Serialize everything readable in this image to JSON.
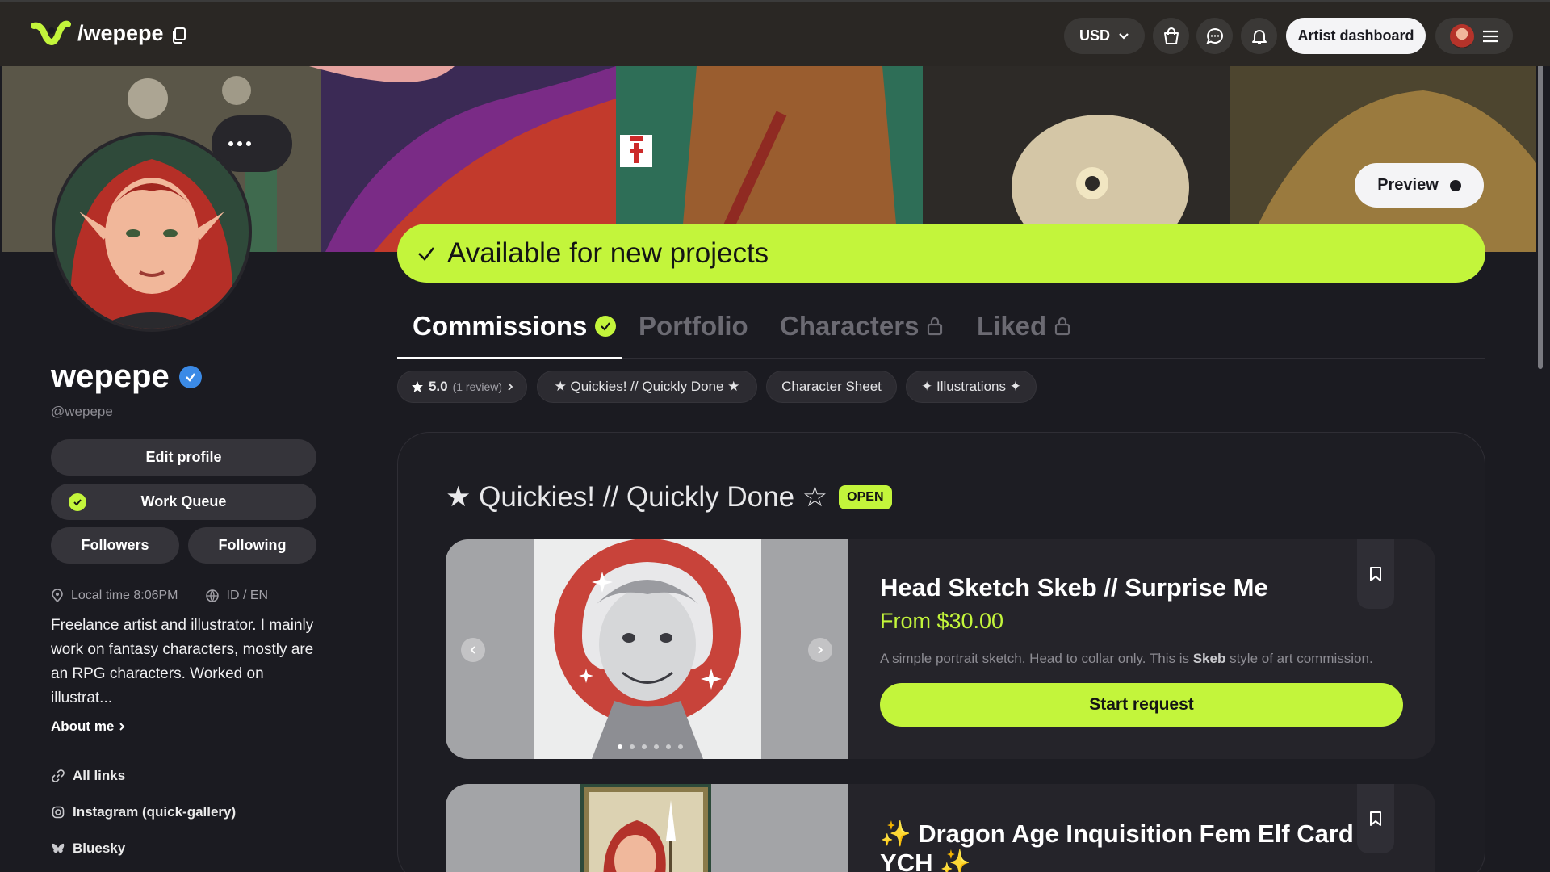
{
  "header": {
    "handle": "/wepepe",
    "currency": "USD",
    "artist_dashboard": "Artist dashboard",
    "icons": [
      "logo-icon",
      "copy-icon",
      "cart-icon",
      "chat-icon",
      "bell-icon",
      "menu-icon"
    ]
  },
  "banner": {
    "preview_label": "Preview",
    "availability": "Available for new projects"
  },
  "profile": {
    "username": "wepepe",
    "at_handle": "@wepepe",
    "edit_profile": "Edit profile",
    "work_queue": "Work Queue",
    "followers": "Followers",
    "following": "Following",
    "local_time": "Local time 8:06PM",
    "languages": "ID / EN",
    "bio": "Freelance artist and illustrator. I mainly work on fantasy characters, mostly are an RPG characters. Worked on illustrat...",
    "about_me": "About me",
    "links": [
      {
        "label": "All links",
        "icon": "link-icon"
      },
      {
        "label": "Instagram (quick-gallery)",
        "icon": "instagram-icon"
      },
      {
        "label": "Bluesky",
        "icon": "bluesky-icon"
      }
    ]
  },
  "tabs": [
    {
      "label": "Commissions",
      "active": true,
      "badge": "check"
    },
    {
      "label": "Portfolio",
      "active": false
    },
    {
      "label": "Characters",
      "active": false,
      "badge": "lock"
    },
    {
      "label": "Liked",
      "active": false,
      "badge": "lock"
    }
  ],
  "filters": {
    "rating": "5.0",
    "review_count": "(1 review)",
    "chips": [
      "★ Quickies! // Quickly Done ★",
      "Character Sheet",
      "✦ Illustrations ✦"
    ]
  },
  "section": {
    "title": "★ Quickies! // Quickly Done ☆",
    "status": "OPEN"
  },
  "cards": [
    {
      "title": "Head Sketch Skeb // Surprise Me",
      "price": "From $30.00",
      "desc_before": "A simple portrait sketch. Head to collar only. This is ",
      "desc_bold": "Skeb",
      "desc_after": " style of art commission.",
      "button": "Start request",
      "image_count": 6,
      "active_image": 1
    },
    {
      "title": "✨ Dragon Age Inquisition Fem Elf Card YCH ✨"
    }
  ],
  "colors": {
    "accent": "#c3f53b",
    "background": "#1b1b21",
    "surface": "#25242a",
    "verified": "#3b8ae6"
  }
}
